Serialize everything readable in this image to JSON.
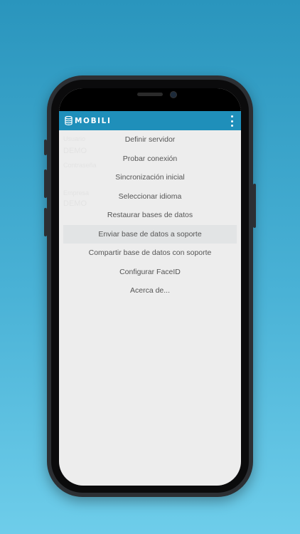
{
  "app": {
    "logo_text": "MOBILI"
  },
  "background": {
    "fields": [
      {
        "label": "Usuario",
        "value": "DEMO"
      },
      {
        "label": "Contraseña",
        "value": ""
      },
      {
        "label": "Empresa",
        "value": "DEMO"
      }
    ]
  },
  "menu": {
    "items": [
      {
        "label": "Definir servidor"
      },
      {
        "label": "Probar conexión"
      },
      {
        "label": "Sincronización inicial"
      },
      {
        "label": "Seleccionar idioma"
      },
      {
        "label": "Restaurar bases de datos"
      },
      {
        "label": "Enviar base de datos a soporte"
      },
      {
        "label": "Compartir base de datos con soporte"
      },
      {
        "label": "Configurar FaceID"
      },
      {
        "label": "Acerca de..."
      }
    ],
    "highlighted_index": 5
  },
  "colors": {
    "appbar": "#1f8fba",
    "menu_background": "#ededed",
    "highlight": "#e2e4e5",
    "text": "#555555"
  }
}
